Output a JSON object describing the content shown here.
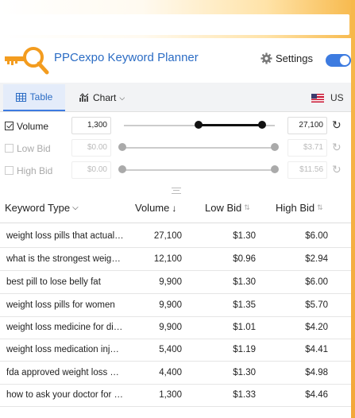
{
  "app": {
    "title": "PPCexpo Keyword Planner",
    "accent_color": "#2b6cc4",
    "toggle_on": true
  },
  "header": {
    "settings_label": "Settings",
    "logo_icon": "magnifier-key-logo"
  },
  "tabs": {
    "table_label": "Table",
    "chart_label": "Chart",
    "country": "US",
    "active": "Table"
  },
  "filters": {
    "volume": {
      "label": "Volume",
      "checked": true,
      "min": "1,300",
      "max": "27,100"
    },
    "low_bid": {
      "label": "Low Bid",
      "checked": false,
      "min": "$0.00",
      "max": "$3.71"
    },
    "high_bid": {
      "label": "High Bid",
      "checked": false,
      "min": "$0.00",
      "max": "$11.56"
    }
  },
  "table": {
    "columns": [
      "Keyword Type",
      "Volume",
      "Low Bid",
      "High Bid"
    ],
    "rows": [
      {
        "keyword": "weight loss pills that actually work",
        "volume": "27,100",
        "low": "$1.30",
        "high": "$6.00"
      },
      {
        "keyword": "what is the strongest weight loss pill",
        "volume": "12,100",
        "low": "$0.96",
        "high": "$2.94"
      },
      {
        "keyword": "best pill to lose belly fat",
        "volume": "9,900",
        "low": "$1.30",
        "high": "$6.00"
      },
      {
        "keyword": "weight loss pills for women",
        "volume": "9,900",
        "low": "$1.35",
        "high": "$5.70"
      },
      {
        "keyword": "weight loss medicine for diabetes",
        "volume": "9,900",
        "low": "$1.01",
        "high": "$4.20"
      },
      {
        "keyword": "weight loss medication injections",
        "volume": "5,400",
        "low": "$1.19",
        "high": "$4.41"
      },
      {
        "keyword": "fda approved weight loss pills",
        "volume": "4,400",
        "low": "$1.30",
        "high": "$4.98"
      },
      {
        "keyword": "how to ask your doctor for weight loss pills",
        "volume": "1,300",
        "low": "$1.33",
        "high": "$4.46"
      }
    ]
  }
}
